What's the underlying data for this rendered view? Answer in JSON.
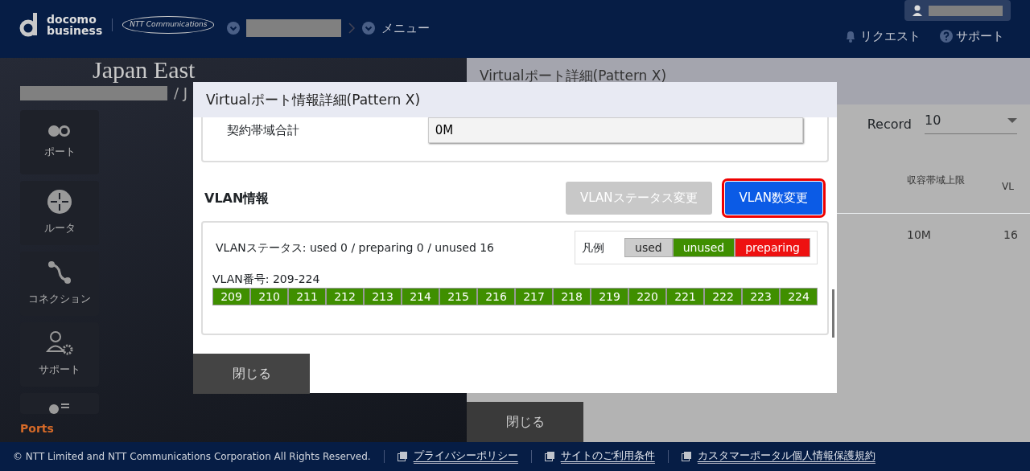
{
  "header": {
    "logo": {
      "line1": "docomo",
      "line2": "business",
      "partner": "NTT Communications"
    },
    "breadcrumb": [
      {
        "kind": "redacted"
      },
      {
        "kind": "link",
        "label": "メニュー"
      }
    ],
    "user": {
      "kind": "redacted"
    },
    "links": [
      {
        "label": "リクエスト"
      },
      {
        "label": "サポート"
      }
    ]
  },
  "background_page": {
    "heading": "Japan East",
    "path_tail": "/ J",
    "sidebar": [
      {
        "label": "ポート"
      },
      {
        "label": "ルータ"
      },
      {
        "label": "コネクション"
      },
      {
        "label": "サポート"
      },
      {
        "kind": "partial"
      }
    ],
    "section_label": "Ports"
  },
  "background_panel": {
    "title": "Virtualポート詳細(Pattern X)",
    "record_label": "Record",
    "record_value": "10",
    "columns": [
      "収容帯域上限",
      "VL"
    ],
    "rows": [
      [
        "10M",
        "16"
      ]
    ],
    "close_button": "閉じる"
  },
  "modal": {
    "title": "Virtualポート情報詳細(Pattern X)",
    "field": {
      "label": "契約帯域合計",
      "value": "0M"
    },
    "vlan_heading": "VLAN情報",
    "buttons": [
      {
        "label": "VLANステータス変更",
        "disabled": true,
        "highlighted": false
      },
      {
        "label": "VLAN数変更",
        "disabled": false,
        "highlighted": true
      }
    ],
    "status_text": "VLANステータス: used 0 / preparing 0 / unused 16",
    "legend_label": "凡例",
    "legend": [
      {
        "label": "used",
        "color": "#cccccc"
      },
      {
        "label": "unused",
        "color": "#3f8f00"
      },
      {
        "label": "preparing",
        "color": "#ee1111"
      }
    ],
    "range_label": "VLAN番号: 209-224",
    "vlans": [
      {
        "number": "209",
        "color": "#3f8f00"
      },
      {
        "number": "210",
        "color": "#3f8f00"
      },
      {
        "number": "211",
        "color": "#3f8f00"
      },
      {
        "number": "212",
        "color": "#3f8f00"
      },
      {
        "number": "213",
        "color": "#3f8f00"
      },
      {
        "number": "214",
        "color": "#3f8f00"
      },
      {
        "number": "215",
        "color": "#3f8f00"
      },
      {
        "number": "216",
        "color": "#3f8f00"
      },
      {
        "number": "217",
        "color": "#3f8f00"
      },
      {
        "number": "218",
        "color": "#3f8f00"
      },
      {
        "number": "219",
        "color": "#3f8f00"
      },
      {
        "number": "220",
        "color": "#3f8f00"
      },
      {
        "number": "221",
        "color": "#3f8f00"
      },
      {
        "number": "222",
        "color": "#3f8f00"
      },
      {
        "number": "223",
        "color": "#3f8f00"
      },
      {
        "number": "224",
        "color": "#3f8f00"
      }
    ],
    "close_button": "閉じる"
  },
  "footer": {
    "copyright": "© NTT Limited and NTT Communications Corporation All Rights Reserved.",
    "links": [
      "プライバシーポリシー",
      "サイトのご利用条件",
      "カスタマーポータル個人情報保護規約"
    ]
  }
}
